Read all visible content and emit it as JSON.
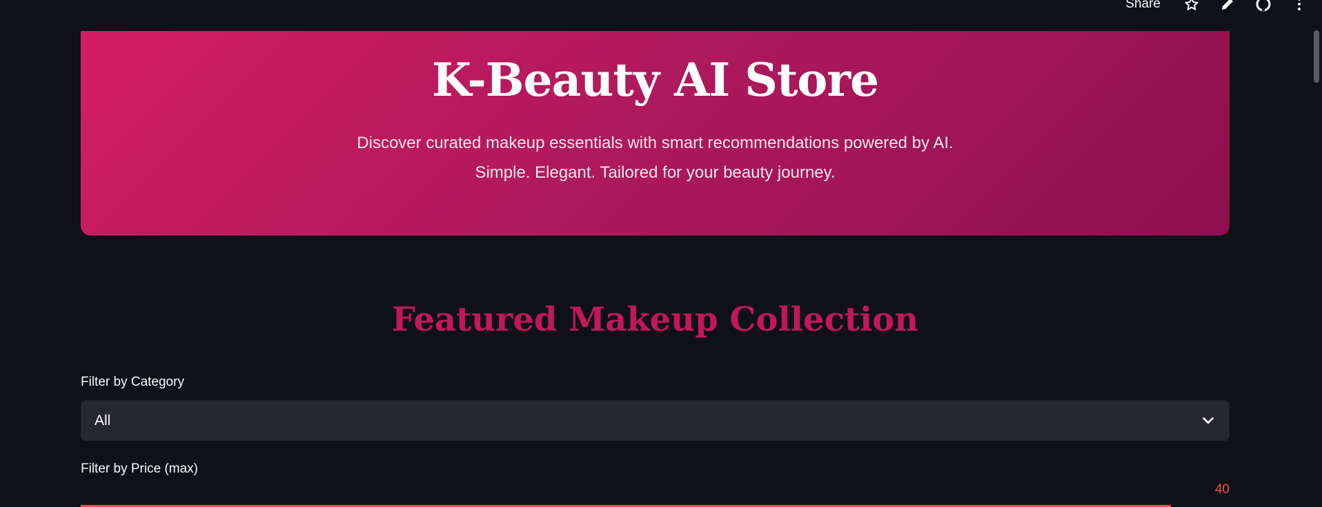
{
  "toolbar": {
    "share_label": "Share",
    "icons": [
      "star-icon",
      "edit-icon",
      "github-icon",
      "more-vert-icon"
    ]
  },
  "hero": {
    "title": "K-Beauty AI Store",
    "subtitle_line1": "Discover curated makeup essentials with smart recommendations powered by AI.",
    "subtitle_line2": "Simple. Elegant. Tailored for your beauty journey."
  },
  "section": {
    "title": "Featured Makeup Collection"
  },
  "filters": {
    "category_label": "Filter by Category",
    "category_value": "All",
    "price_label": "Filter by Price (max)",
    "price_value": "40"
  },
  "colors": {
    "background": "#0e1117",
    "hero_gradient_start": "#d41c63",
    "hero_gradient_end": "#8e0f4f",
    "section_title": "#c2185b",
    "select_bg": "#262730",
    "slider_accent": "#ff4b4b"
  }
}
